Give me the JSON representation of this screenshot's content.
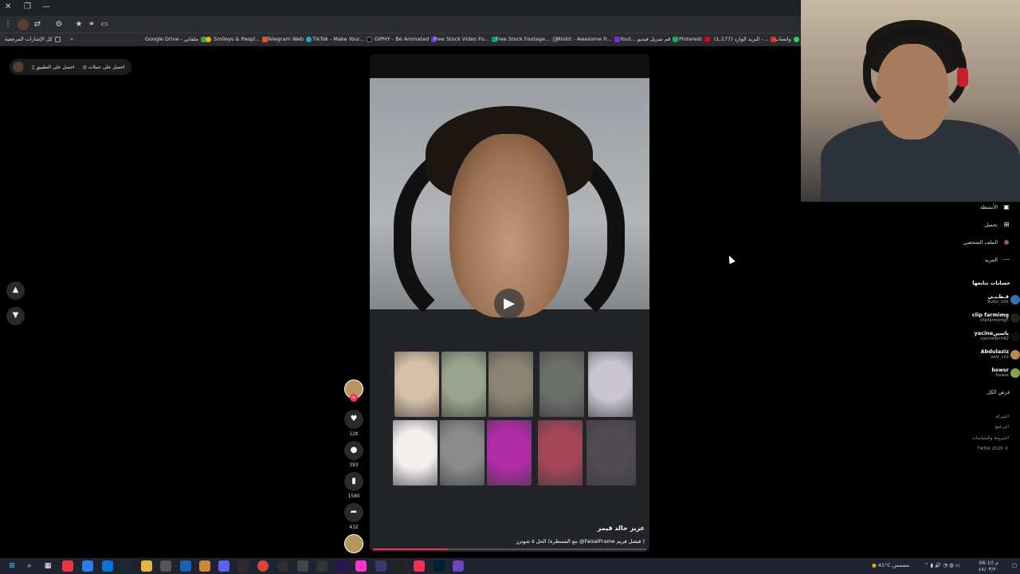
{
  "browser": {
    "window_controls": {
      "close": "✕",
      "restore": "❐",
      "minimize": "—"
    },
    "toolbar_icons": [
      "⋮",
      "⇄",
      "⚙",
      "★",
      "⚭",
      "▭"
    ],
    "bookmarks": [
      {
        "label": "كل الإشارات المرجعية",
        "color": "#888"
      },
      {
        "label": "»",
        "color": "#000"
      },
      {
        "label": "Google Drive - ملفاتي",
        "color": "#34a853"
      },
      {
        "label": "Smileys & Peopl...",
        "color": "#f5b400"
      },
      {
        "label": "Telegram Web",
        "color": "#2aa1da"
      },
      {
        "label": "TikTok - Make Your...",
        "color": "#111"
      },
      {
        "label": "GIPHY - Be Animated",
        "color": "#6f2cf5"
      },
      {
        "label": "Free Stock Video Fo...",
        "color": "#05a081"
      },
      {
        "label": "Free Stock Footage...",
        "color": "#2d2d2d"
      },
      {
        "label": "Mixkit - Awesome fr...",
        "color": "#7b2fd0"
      },
      {
        "label": "Yout... قم بتنزيل فيديو",
        "color": "#20a15e"
      },
      {
        "label": "Pinterest",
        "color": "#e60023"
      },
      {
        "label": "(1,177) البريد الوارد -...",
        "color": "#d93025"
      },
      {
        "label": "واتساب",
        "color": "#25d366"
      }
    ]
  },
  "page": {
    "promo": {
      "get_app": "احصل على التطبيق",
      "get_coins": "احصل على عملات"
    },
    "nav": {
      "up": "▲",
      "down": "▼"
    },
    "video": {
      "play_glyph": "▶",
      "author_name": "عزيز خالد قيمز",
      "caption": "الحل ٥ شوترز (مع المسطرة @FaisalFrame فيصل فريم )",
      "progress": 0.27,
      "thumb_colors": [
        "#d6c1a8",
        "#9aa48d",
        "#8b8272",
        "#6c6e6b",
        "#c9c6d2",
        "#f2f0ef",
        "#8a8a8a",
        "#b12ca8",
        "#a44658",
        "#504c50"
      ]
    },
    "actions": {
      "like_count": "12K",
      "comment_count": "393",
      "save_count": "1580",
      "share_count": "432"
    },
    "sidebar": {
      "menu": [
        {
          "label": "الأنشطة",
          "icon": "▣"
        },
        {
          "label": "تحميل",
          "icon": "⊞"
        },
        {
          "label": "الملف الشخصي",
          "icon": "●"
        },
        {
          "label": "المزيد",
          "icon": "⋯"
        }
      ],
      "following_title": "حسابات تتابعها",
      "accounts": [
        {
          "name": "قـطـبـي",
          "handle": "9utbi_10k",
          "color": "#3a6fb0"
        },
        {
          "name": "clip farmimg",
          "handle": "clipfarmimg5",
          "color": "#222"
        },
        {
          "name": "yacineياسين",
          "handle": "yacinebnh42",
          "color": "#111"
        },
        {
          "name": "Abdulaziz",
          "handle": "aziz_cs2",
          "color": "#b28a54"
        },
        {
          "name": "bswsr",
          "handle": "bswsr",
          "color": "#8aa24a"
        }
      ],
      "see_all": "عرض الكل",
      "footer": [
        "الشركة",
        "البرنامج",
        "الشروط والسياسات",
        "TikTok 2026 ©"
      ]
    }
  },
  "taskbar": {
    "weather": "41°C مشمس",
    "time": "06:10 م",
    "date": "٤٨/٠٣/٢٠"
  }
}
